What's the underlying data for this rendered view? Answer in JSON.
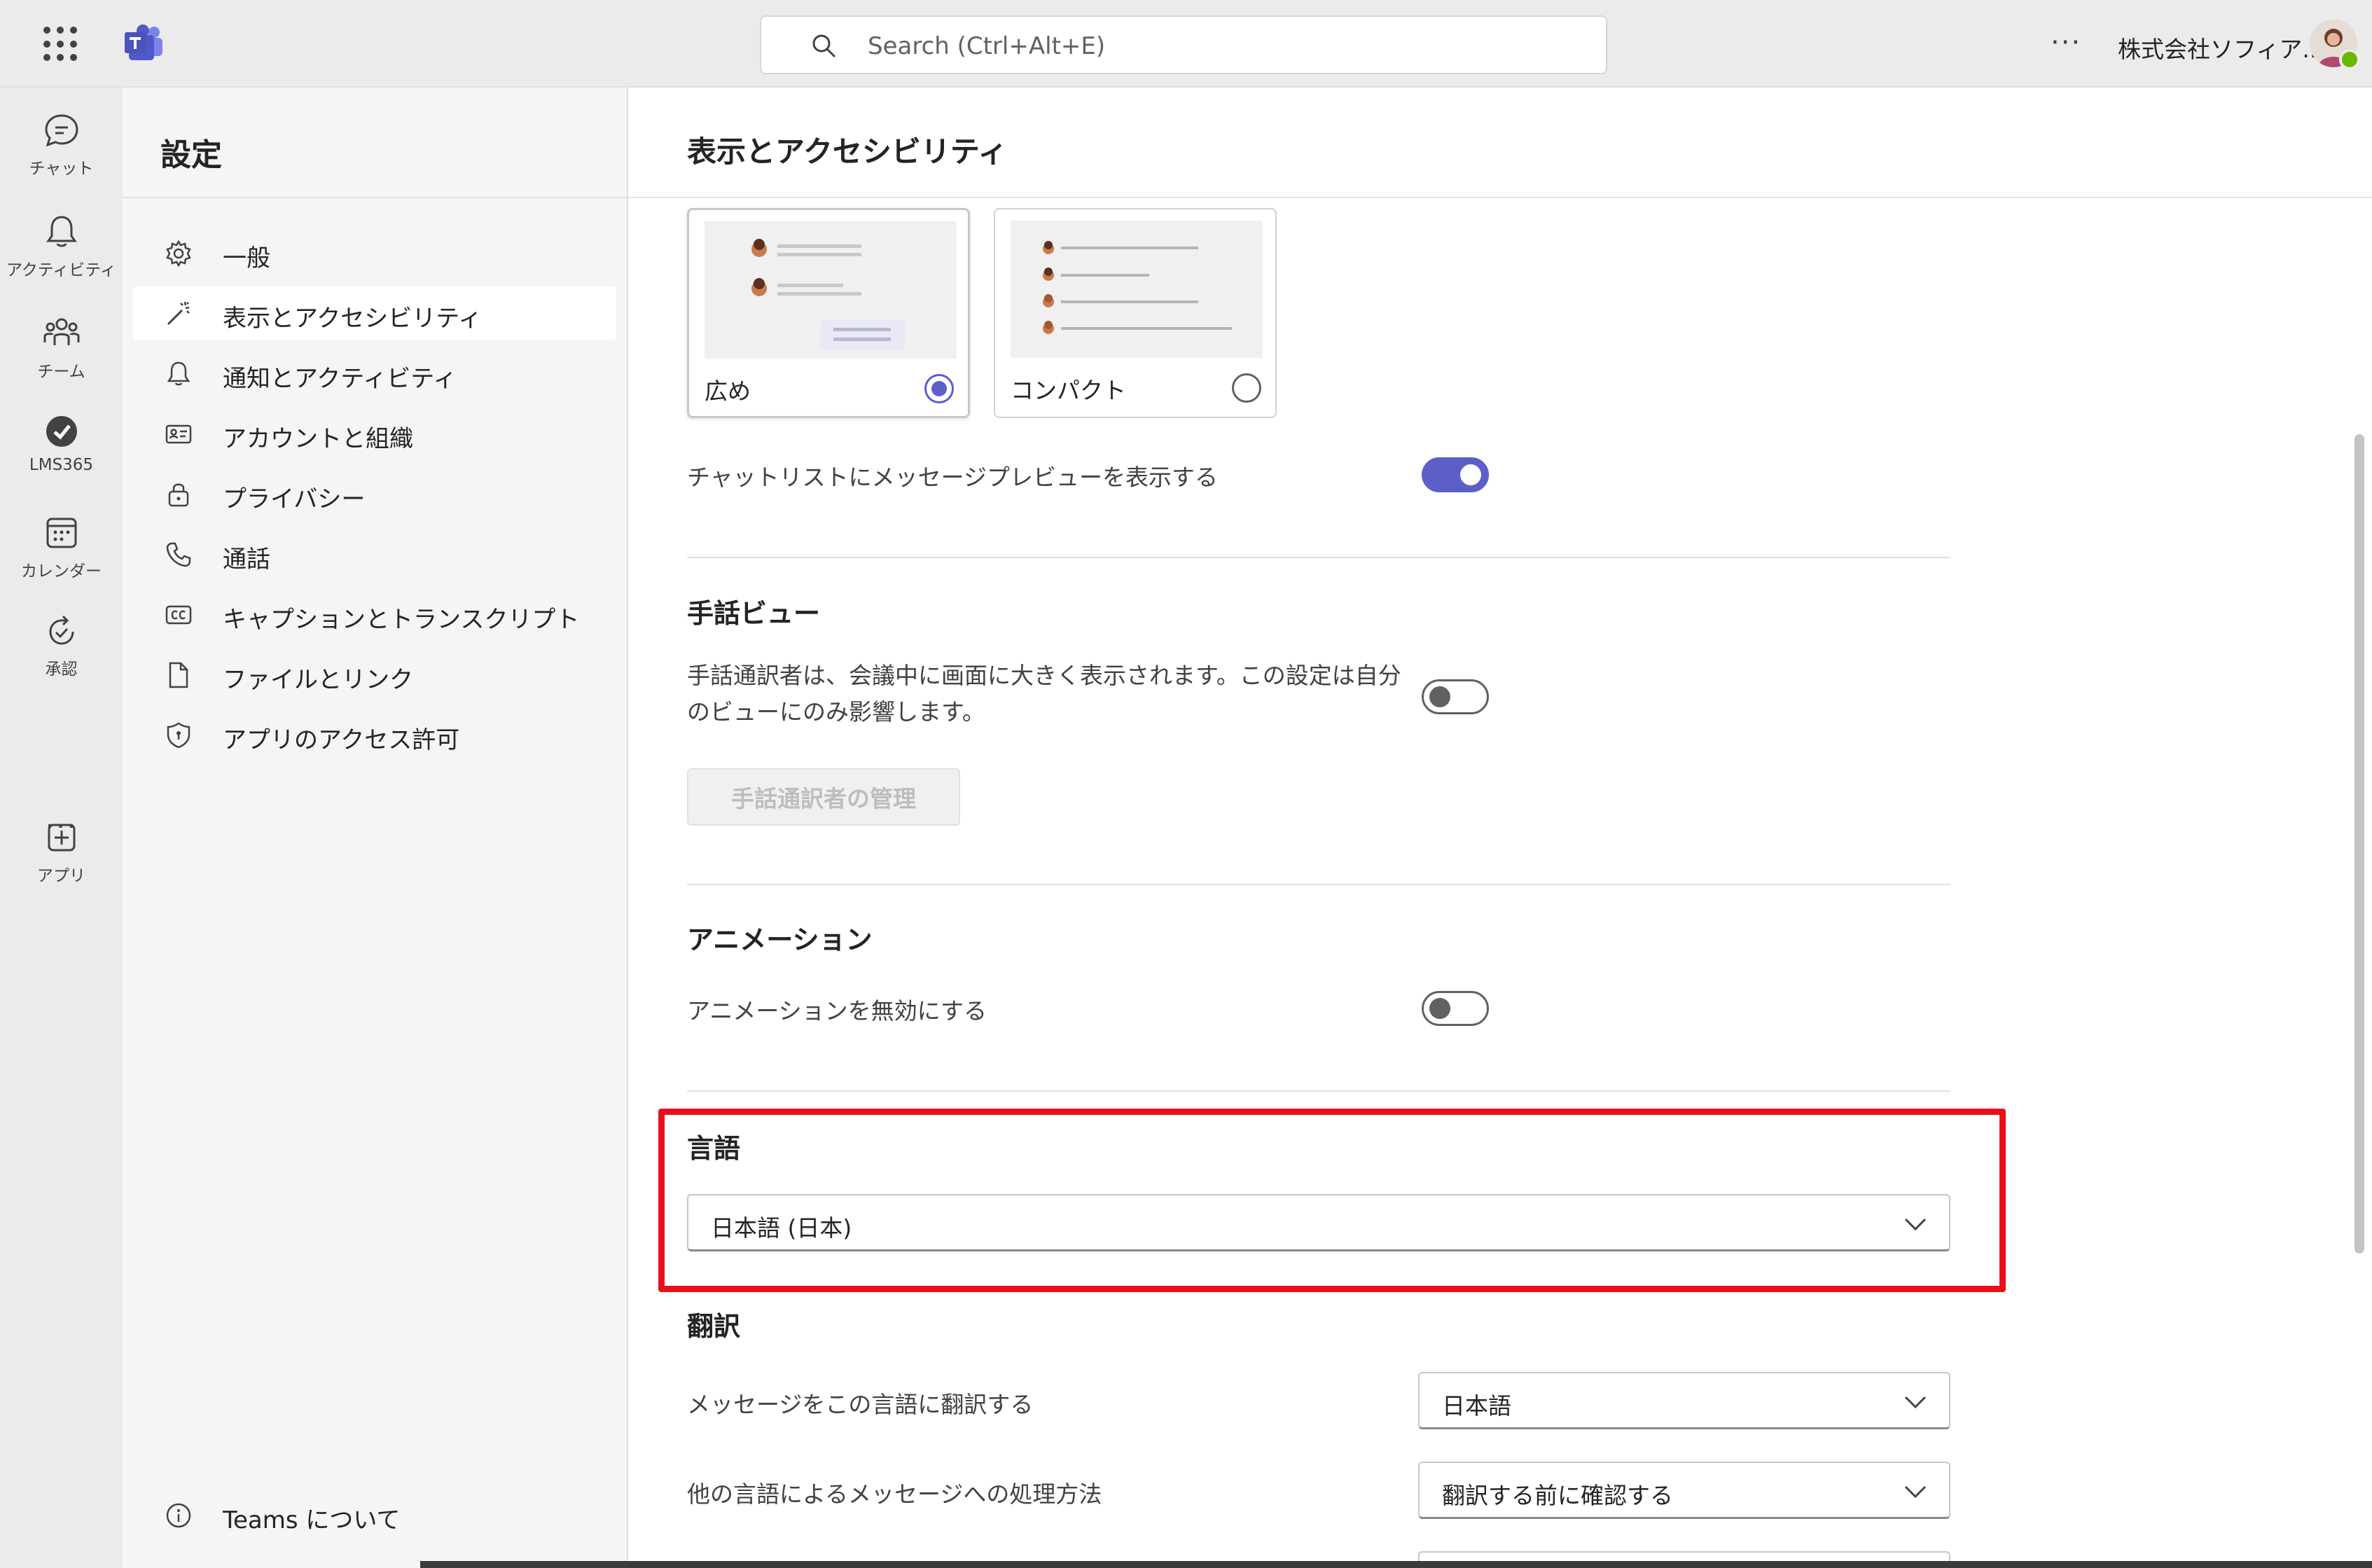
{
  "topbar": {
    "search_placeholder": "Search (Ctrl+Alt+E)",
    "more_label": "···",
    "org_name": "株式会社ソフィア...",
    "icons": {
      "waffle": "app-launcher-icon",
      "logo": "teams-logo-icon",
      "search": "search-icon"
    }
  },
  "rail": {
    "items": [
      {
        "label": "チャット",
        "icon": "chat-icon"
      },
      {
        "label": "アクティビティ",
        "icon": "bell-icon"
      },
      {
        "label": "チーム",
        "icon": "teams-icon"
      },
      {
        "label": "LMS365",
        "icon": "lms365-icon"
      },
      {
        "label": "カレンダー",
        "icon": "calendar-icon"
      },
      {
        "label": "承認",
        "icon": "approvals-icon"
      },
      {
        "label": "アプリ",
        "icon": "add-app-icon"
      }
    ],
    "more_label": "···"
  },
  "nav": {
    "title": "設定",
    "items": [
      {
        "label": "一般",
        "icon": "gear-icon"
      },
      {
        "label": "表示とアクセシビリティ",
        "icon": "magic-wand-icon",
        "active": true
      },
      {
        "label": "通知とアクティビティ",
        "icon": "bell-icon"
      },
      {
        "label": "アカウントと組織",
        "icon": "contact-card-icon"
      },
      {
        "label": "プライバシー",
        "icon": "lock-icon"
      },
      {
        "label": "通話",
        "icon": "phone-icon"
      },
      {
        "label": "キャプションとトランスクリプト",
        "icon": "cc-icon"
      },
      {
        "label": "ファイルとリンク",
        "icon": "file-icon"
      },
      {
        "label": "アプリのアクセス許可",
        "icon": "shield-icon"
      }
    ],
    "footer": {
      "label": "Teams について",
      "icon": "info-icon"
    }
  },
  "main": {
    "title": "表示とアクセシビリティ",
    "density": {
      "options": [
        {
          "label": "広め",
          "selected": true
        },
        {
          "label": "コンパクト",
          "selected": false
        }
      ]
    },
    "chat_preview": {
      "label": "チャットリストにメッセージプレビューを表示する",
      "on": true
    },
    "sign_language": {
      "heading": "手話ビュー",
      "description": "手話通訳者は、会議中に画面に大きく表示されます。この設定は自分のビューにのみ影響します。",
      "on": false,
      "manage_button": "手話通訳者の管理"
    },
    "animation": {
      "heading": "アニメーション",
      "label": "アニメーションを無効にする",
      "on": false
    },
    "language": {
      "heading": "言語",
      "value": "日本語 (日本)"
    },
    "translation": {
      "heading": "翻訳",
      "translate_label": "メッセージをこの言語に翻訳する",
      "translate_value": "日本語",
      "handling_label": "他の言語によるメッセージへの処理方法",
      "handling_value": "翻訳する前に確認する"
    }
  },
  "colors": {
    "accent": "#5b5fc7",
    "highlight": "#e8101a"
  }
}
